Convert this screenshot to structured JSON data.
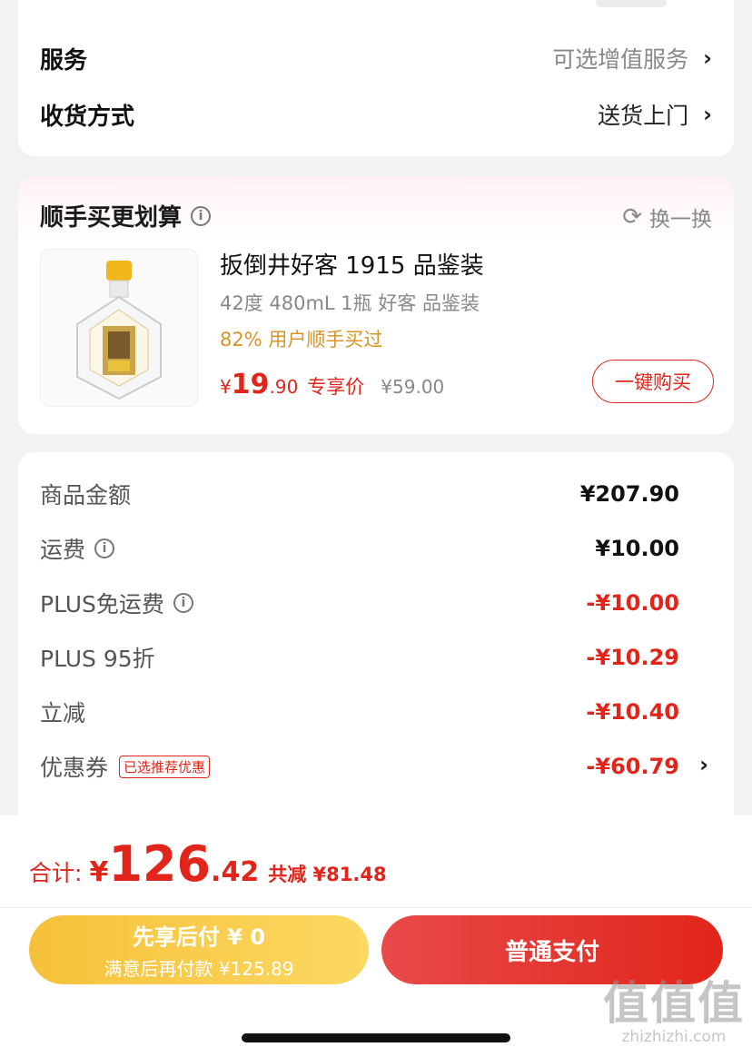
{
  "top_card": {
    "service": {
      "label": "服务",
      "value": "可选增值服务"
    },
    "delivery": {
      "label": "收货方式",
      "value": "送货上门"
    }
  },
  "upsell": {
    "title": "顺手买更划算",
    "refresh_label": "换一换",
    "product": {
      "name": "扳倒井好客 1915 品鉴装",
      "spec": "42度 480mL 1瓶 好客 品鉴装",
      "social_proof": "82% 用户顺手买过",
      "price_currency": "¥",
      "price_int": "19",
      "price_dec": ".90",
      "price_tag": "专享价",
      "original_price": "¥59.00",
      "buy_button": "一键购买"
    }
  },
  "summary": {
    "rows": [
      {
        "label": "商品金额",
        "value": "¥207.90"
      },
      {
        "label": "运费",
        "value": "¥10.00"
      },
      {
        "label": "PLUS免运费",
        "value": "-¥10.00"
      },
      {
        "label": "PLUS 95折",
        "value": "-¥10.29"
      },
      {
        "label": "立减",
        "value": "-¥10.40"
      },
      {
        "label": "优惠券",
        "badge": "已选推荐优惠",
        "value": "-¥60.79"
      }
    ]
  },
  "bottom": {
    "total_label": "合计:",
    "currency": "¥",
    "total_int": "126",
    "total_dec": ".42",
    "saved": "共减 ¥81.48",
    "pay_later_line1": "先享后付 ¥ 0",
    "pay_later_line2": "满意后再付款 ¥125.89",
    "pay_button": "普通支付"
  },
  "watermark": {
    "big": "值值值",
    "small": "zhizhizhi.com"
  },
  "colors": {
    "accent_red": "#e1251b",
    "gold": "#f6c13a",
    "social_orange": "#d99427"
  }
}
